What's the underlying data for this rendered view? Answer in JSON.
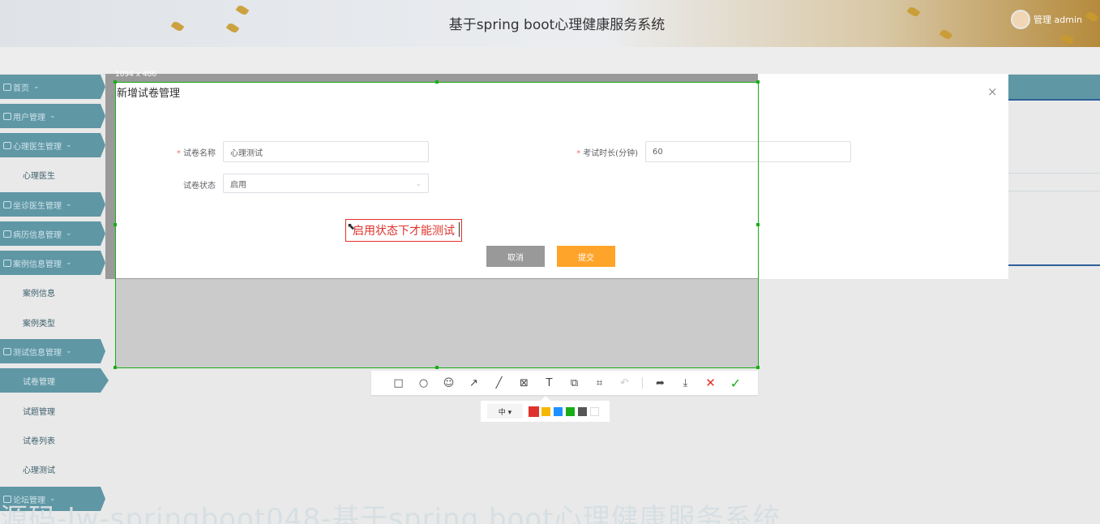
{
  "app": {
    "title": "基于spring boot心理健康服务系统",
    "user_name": "管理 admin"
  },
  "sidebar": {
    "items": [
      {
        "label": "首页",
        "type": "group"
      },
      {
        "label": "用户管理",
        "type": "group"
      },
      {
        "label": "心理医生管理",
        "type": "group"
      },
      {
        "label": "心理医生",
        "type": "sub"
      },
      {
        "label": "坐诊医生管理",
        "type": "group"
      },
      {
        "label": "病历信息管理",
        "type": "group"
      },
      {
        "label": "案例信息管理",
        "type": "group"
      },
      {
        "label": "案例信息",
        "type": "sub"
      },
      {
        "label": "案例类型",
        "type": "sub"
      },
      {
        "label": "测试信息管理",
        "type": "group"
      },
      {
        "label": "试卷管理",
        "type": "sub-active"
      },
      {
        "label": "试题管理",
        "type": "sub"
      },
      {
        "label": "试卷列表",
        "type": "sub"
      },
      {
        "label": "心理测试",
        "type": "sub"
      },
      {
        "label": "论坛管理",
        "type": "group"
      }
    ]
  },
  "watermark": "源码-lw-springboot048-基于spring boot心理健康服务系统",
  "dialog": {
    "title": "新增试卷管理",
    "close_label": "×",
    "fields": {
      "name_label": "试卷名称",
      "name_value": "心理测试",
      "duration_label": "考试时长(分钟)",
      "duration_value": "60",
      "status_label": "试卷状态",
      "status_value": "启用"
    },
    "annotation_text": "启用状态下才能测试",
    "cancel_label": "取消",
    "submit_label": "提交"
  },
  "capture": {
    "size_label": "1094 x 486",
    "tools": [
      {
        "name": "rectangle-tool-icon",
        "glyph": "□"
      },
      {
        "name": "ellipse-tool-icon",
        "glyph": "○"
      },
      {
        "name": "emoji-tool-icon",
        "glyph": "☺"
      },
      {
        "name": "arrow-tool-icon",
        "glyph": "↗"
      },
      {
        "name": "line-tool-icon",
        "glyph": "╱"
      },
      {
        "name": "mosaic-tool-icon",
        "glyph": "⊠"
      },
      {
        "name": "text-tool-icon",
        "glyph": "T"
      },
      {
        "name": "copy-tool-icon",
        "glyph": "⧉"
      },
      {
        "name": "ocr-tool-icon",
        "glyph": "⌗"
      },
      {
        "name": "undo-tool-icon",
        "glyph": "↶",
        "disabled": true
      }
    ],
    "actions": [
      {
        "name": "share-icon",
        "glyph": "➦"
      },
      {
        "name": "download-icon",
        "glyph": "⤓"
      },
      {
        "name": "cancel-capture-icon",
        "glyph": "✕",
        "cls": "cancel"
      },
      {
        "name": "confirm-capture-icon",
        "glyph": "✓",
        "cls": "ok"
      }
    ],
    "text_size": "中 ▾",
    "colors": [
      "#e0322c",
      "#f5b800",
      "#1e90ff",
      "#1aad19",
      "#555555",
      "#ffffff"
    ],
    "selected_color": "#e0322c"
  }
}
